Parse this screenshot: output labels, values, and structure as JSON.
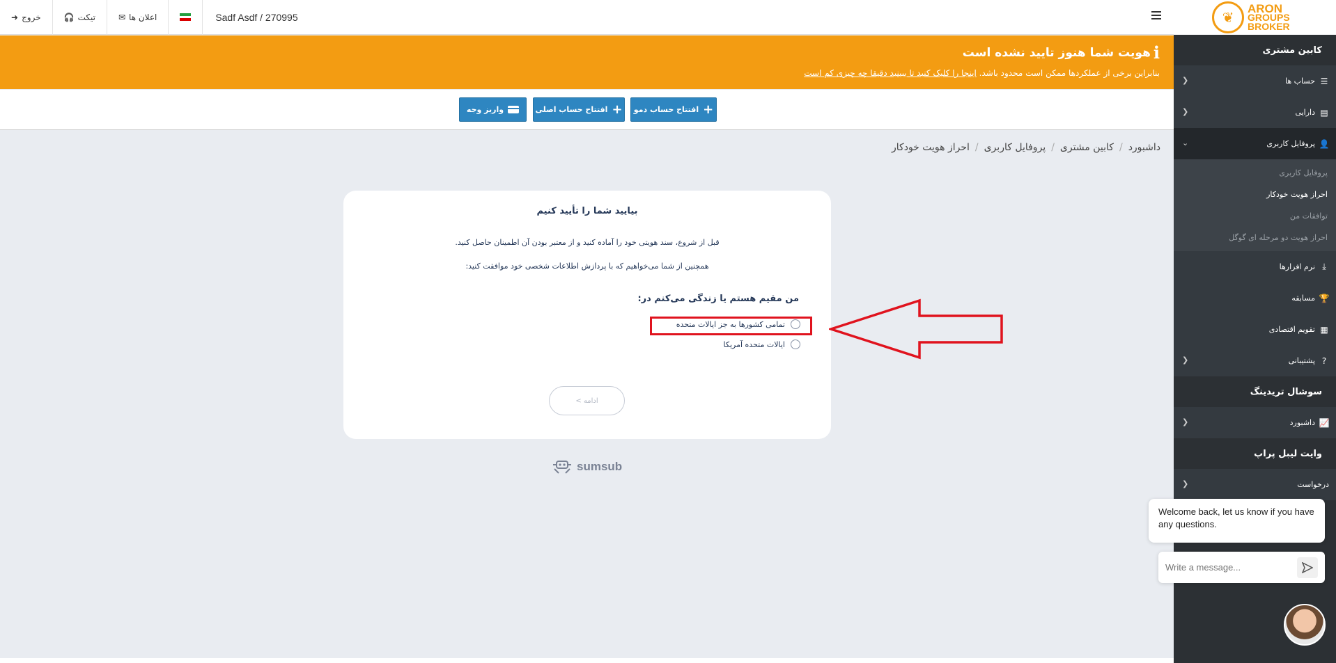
{
  "topbar": {
    "user": "Sadf Asdf / 270995",
    "announcements": "اعلان ها",
    "ticket": "تیکت",
    "logout": "خروج"
  },
  "banner": {
    "title": "هویت شما هنوز تایید نشده است",
    "text": "بنابراین برخی از عملکردها ممکن است محدود باشد.",
    "link": "اینجا را کلیک کنید تا ببینید دقیقا چه چیزی کم است"
  },
  "toolbar": {
    "demo": "افتتاح حساب دمو",
    "real": "افتتاح حساب اصلی",
    "deposit": "واریز وجه"
  },
  "breadcrumb": [
    "داشبورد",
    "کابین مشتری",
    "پروفایل کاربری",
    "احراز هویت خودکار"
  ],
  "verify": {
    "title": "بیایید شما را تأیید کنیم",
    "p1": "قبل از شروع، سند هویتی خود را آماده کنید و از معتبر بودن آن اطمینان حاصل کنید.",
    "p2": "همچنین از شما می‌خواهیم که با پردازش اطلاعات شخصی خود موافقت کنید:",
    "question": "من مقیم هستم یا زندگی می‌کنم در:",
    "option1": "تمامی کشورها به جز ایالات متحده",
    "option2": "ایالات متحده آمریکا",
    "continue": "ادامه >"
  },
  "sumsub": "sumsub",
  "sidebar": {
    "logo_line1": "ARON",
    "logo_line2": "GROUPS",
    "logo_line3": "BROKER",
    "section1": "کابین مشتری",
    "accounts": "حساب ها",
    "assets": "دارایی",
    "profile": "پروفایل کاربری",
    "sub_profile": "پروفایل کاربری",
    "sub_kyc": "احراز هویت خودکار",
    "sub_agreements": "توافقات من",
    "sub_2fa": "احراز هویت دو مرحله ای گوگل",
    "software": "نرم افزارها",
    "contest": "مسابقه",
    "calendar": "تقویم اقتصادی",
    "support": "پشتیبانی",
    "section2": "سوشال تریدینگ",
    "dashboard": "داشبورد",
    "section3": "وایت لیبل پراپ",
    "request": "درخواست"
  },
  "chat": {
    "welcome": "Welcome back, let us know if you have any questions.",
    "placeholder": "Write a message..."
  }
}
